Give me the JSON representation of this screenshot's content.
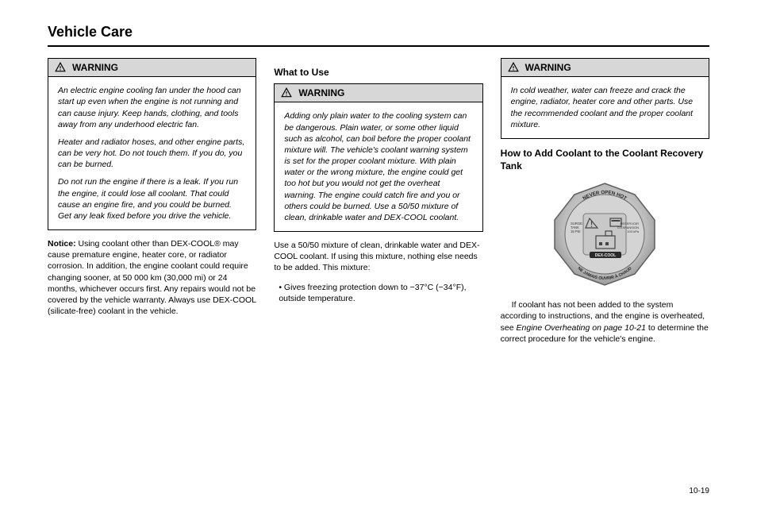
{
  "header": {
    "title": "Vehicle Care"
  },
  "warning_label": "WARNING",
  "col1": {
    "warn_p1": "An electric engine cooling fan under the hood can start up even when the engine is not running and can cause injury. Keep hands, clothing, and tools away from any underhood electric fan.",
    "warn_p2": "Heater and radiator hoses, and other engine parts, can be very hot. Do not touch them. If you do, you can be burned.",
    "warn_p3": "Do not run the engine if there is a leak. If you run the engine, it could lose all coolant. That could cause an engine fire, and you could be burned. Get any leak fixed before you drive the vehicle.",
    "notice_label": "Notice:",
    "notice_body": " Using coolant other than DEX-COOL® may cause premature engine, heater core, or radiator corrosion. In addition, the engine coolant could require changing sooner, at 50 000 km (30,000 mi) or 24 months, whichever occurs first. Any repairs would not be covered by the vehicle warranty. Always use DEX-COOL (silicate-free) coolant in the vehicle."
  },
  "col2": {
    "h3": "What to Use",
    "warn_p1": "Adding only plain water to the cooling system can be dangerous. Plain water, or some other liquid such as alcohol, can boil before the proper coolant mixture will. The vehicle's coolant warning system is set for the proper coolant mixture. With plain water or the wrong mixture, the engine could get too hot but you would not get the overheat warning. The engine could catch fire and you or others could be burned. Use a 50/50 mixture of clean, drinkable water and DEX-COOL coolant.",
    "p2a": "Use a 50/50 mixture of clean, drinkable water and DEX-COOL coolant. If using this mixture, nothing else needs to be added. This mixture:",
    "p2b": "• Gives freezing protection down to −37°C (−34°F), outside temperature."
  },
  "col3": {
    "warn_p1": "In cold weather, water can freeze and crack the engine, radiator, heater core and other parts. Use the recommended coolant and the proper coolant mixture.",
    "h3": "How to Add Coolant to the Coolant Recovery Tank",
    "p2": "If coolant has not been added to the system according to instructions, and the engine is overheated, see",
    "link": "Engine Overheating on page 10-21",
    "p2b": " to determine the correct procedure for the vehicle's engine."
  },
  "cap": {
    "top": "NEVER OPEN HOT",
    "bottom": "NE JAMAIS OUVRIR À CHAUD",
    "left1": "SURGE",
    "left2": "TANK",
    "left3": "15 PSI",
    "right1": "RESERVOIR",
    "right2": "D'EXPANSION",
    "right3": "103 kPa",
    "brand": "DEX-COOL"
  },
  "footer": {
    "page": "10-19"
  }
}
